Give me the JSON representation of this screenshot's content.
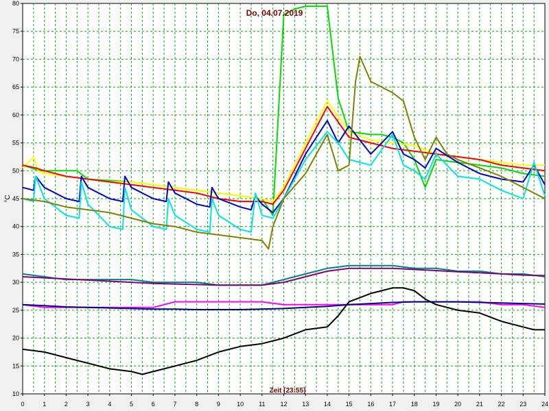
{
  "chart_data": {
    "type": "line",
    "title": "Do, 04.07.2019",
    "xlabel": "Zeit [23:55]",
    "ylabel": "°C",
    "xlim": [
      0,
      24
    ],
    "ylim": [
      10,
      80
    ],
    "x_ticks": [
      "0",
      "1",
      "2",
      "3",
      "4",
      "5",
      "6",
      "7",
      "8",
      "9",
      "10",
      "11",
      "12",
      "13",
      "14",
      "15",
      "16",
      "17",
      "18",
      "19",
      "20",
      "21",
      "22",
      "23",
      "24"
    ],
    "y_ticks": [
      "10",
      "15",
      "20",
      "25",
      "30",
      "35",
      "40",
      "45",
      "50",
      "55",
      "60",
      "65",
      "70",
      "75",
      "80"
    ],
    "grid": true,
    "series": [
      {
        "color": "#00dd00",
        "x": [
          0,
          0.8,
          2.5,
          3,
          5,
          7,
          9,
          10,
          11,
          11.5,
          12,
          12.5,
          13,
          13.5,
          14,
          14.5,
          15,
          16,
          16.5,
          17,
          17.5,
          18,
          18.5,
          19,
          20,
          21,
          22,
          23,
          24
        ],
        "y": [
          51,
          50,
          50,
          48.5,
          48,
          47,
          46,
          45.5,
          45,
          42,
          78,
          79,
          79.5,
          79.5,
          79.5,
          63,
          57,
          56.5,
          56.5,
          56,
          55,
          52,
          47,
          52,
          51.5,
          51,
          50.5,
          49.5,
          49
        ]
      },
      {
        "color": "#ffff00",
        "x": [
          0,
          0.5,
          0.7,
          1,
          2,
          3,
          4,
          5,
          6,
          7,
          8,
          9,
          10,
          11,
          11.5,
          12,
          13,
          14,
          15,
          16,
          17,
          18,
          19,
          20,
          21,
          22,
          23,
          24
        ],
        "y": [
          50.5,
          52.5,
          50,
          49.5,
          49,
          48.5,
          48,
          48,
          47.5,
          47,
          46.5,
          46,
          45.5,
          45,
          44.5,
          47,
          55,
          62.5,
          57,
          55.5,
          55,
          54.5,
          53,
          52.5,
          52,
          51.5,
          51,
          51
        ]
      },
      {
        "color": "#ff0000",
        "x": [
          0,
          0.6,
          1,
          2,
          3,
          4,
          5,
          6,
          7,
          8,
          9,
          10,
          11,
          11.5,
          12,
          13,
          14,
          15,
          16,
          17,
          18,
          19,
          20,
          21,
          22,
          23,
          24
        ],
        "y": [
          51,
          50.5,
          50,
          49,
          48.5,
          48,
          47.5,
          47,
          46.5,
          46,
          45,
          44.5,
          44.5,
          44,
          46.5,
          54,
          61.5,
          56,
          55,
          54,
          53.5,
          53,
          52.5,
          52,
          51,
          50.5,
          50
        ]
      },
      {
        "color": "#0000cc",
        "x": [
          0,
          0.5,
          0.6,
          1,
          2,
          2.6,
          2.7,
          3,
          4,
          4.6,
          4.7,
          5,
          6,
          6.6,
          6.7,
          7,
          8,
          8.6,
          8.7,
          9,
          10,
          10.5,
          10.7,
          11,
          11.5,
          12,
          13,
          14,
          14.5,
          15,
          16,
          17,
          17.5,
          18,
          18.5,
          19,
          20,
          21,
          22,
          23,
          23.5,
          24
        ],
        "y": [
          47,
          46.5,
          49,
          47,
          45,
          44.5,
          49,
          47,
          45,
          44.5,
          49,
          47,
          45,
          44.5,
          48,
          46,
          44,
          43.5,
          47,
          45,
          43.5,
          43,
          45.5,
          44,
          42.5,
          45,
          53,
          59,
          55,
          58,
          53,
          57,
          53,
          52,
          50.5,
          54,
          51.5,
          49.5,
          48.5,
          48,
          51,
          47.5
        ]
      },
      {
        "color": "#00e5e5",
        "x": [
          0,
          0.5,
          0.6,
          1,
          2,
          2.6,
          2.7,
          3,
          4,
          4.6,
          4.7,
          5,
          6,
          6.6,
          6.7,
          7,
          8,
          8.6,
          8.7,
          9,
          10,
          10.5,
          10.7,
          11,
          11.5,
          12,
          13,
          14,
          14.5,
          15,
          16,
          17,
          17.5,
          18,
          18.5,
          19,
          20,
          21,
          22,
          23,
          23.5,
          24
        ],
        "y": [
          45,
          44.5,
          49,
          45,
          42,
          41.5,
          48,
          44,
          40,
          39.5,
          47,
          43,
          40,
          39.5,
          45,
          42,
          39.5,
          39,
          45,
          42,
          39.5,
          39,
          46,
          42,
          41.5,
          45,
          52,
          57,
          55,
          52,
          51,
          56.5,
          51,
          50,
          48.5,
          53,
          49,
          48.5,
          46.5,
          45,
          51.5,
          45.5
        ]
      },
      {
        "color": "#808000",
        "x": [
          0,
          1,
          2,
          3,
          4,
          5,
          6,
          7,
          8,
          9,
          10,
          11,
          11.3,
          11.5,
          12,
          13,
          14,
          14.5,
          15,
          15.3,
          15.5,
          16,
          17,
          17.5,
          18,
          18.5,
          19,
          19.5,
          20,
          21,
          22,
          23,
          24
        ],
        "y": [
          45,
          44.5,
          43.5,
          43,
          42.5,
          41.5,
          40.5,
          40,
          39,
          38.5,
          38,
          37.5,
          36,
          40,
          45,
          49.5,
          56.5,
          50,
          51,
          66,
          70.5,
          66,
          64,
          62.5,
          56,
          52,
          56,
          53,
          52,
          50.5,
          49,
          47,
          45
        ]
      },
      {
        "color": "#008080",
        "x": [
          0,
          1,
          2,
          3,
          4,
          5,
          6,
          7,
          8,
          9,
          10,
          11,
          12,
          13,
          14,
          15,
          16,
          17,
          18,
          19,
          20,
          21,
          22,
          23,
          24
        ],
        "y": [
          31.5,
          31,
          30.5,
          30.5,
          30.5,
          30.5,
          30,
          30,
          30,
          29.5,
          29.5,
          29.5,
          30.5,
          31.5,
          32.5,
          33,
          33,
          33,
          32.5,
          32.5,
          32,
          32,
          31.5,
          31.5,
          31
        ]
      },
      {
        "color": "#800080",
        "x": [
          0,
          1,
          2,
          3,
          4,
          5,
          6,
          7,
          8,
          9,
          10,
          11,
          12,
          13,
          14,
          15,
          16,
          17,
          18,
          19,
          20,
          21,
          22,
          23,
          24
        ],
        "y": [
          31,
          30.8,
          30.6,
          30.4,
          30.2,
          30,
          29.8,
          29.7,
          29.6,
          29.5,
          29.5,
          29.5,
          30,
          31,
          32,
          32.5,
          32.5,
          32.5,
          32.3,
          32.1,
          31.9,
          31.7,
          31.5,
          31.3,
          31.2
        ]
      },
      {
        "color": "#ff00ff",
        "x": [
          0,
          1,
          2,
          3,
          4,
          5,
          6,
          7,
          8,
          9,
          10,
          11,
          12,
          13,
          14,
          15,
          16,
          17,
          17.5,
          18,
          19,
          20,
          21,
          22,
          23,
          24
        ],
        "y": [
          26,
          25.5,
          25.5,
          25.5,
          25.5,
          25.5,
          25.5,
          26.5,
          26.5,
          26.5,
          26.5,
          26.5,
          26,
          26,
          26,
          26,
          26,
          26,
          26.5,
          26.5,
          26.5,
          26.5,
          26.5,
          26,
          26,
          25.5
        ]
      },
      {
        "color": "#000080",
        "x": [
          0,
          1,
          2,
          3,
          4,
          5,
          6,
          7,
          8,
          9,
          10,
          11,
          12,
          13,
          14,
          15,
          16,
          17,
          18,
          19,
          20,
          21,
          22,
          23,
          24
        ],
        "y": [
          26,
          25.8,
          25.6,
          25.5,
          25.4,
          25.3,
          25.2,
          25.2,
          25.1,
          25.1,
          25.1,
          25.2,
          25.3,
          25.5,
          25.7,
          26,
          26.2,
          26.4,
          26.5,
          26.5,
          26.5,
          26.4,
          26.3,
          26.2,
          26.1
        ]
      },
      {
        "color": "#000000",
        "x": [
          0,
          1,
          2,
          3,
          4,
          5,
          5.5,
          6,
          7,
          8,
          9,
          10,
          11,
          12,
          13,
          14,
          14.5,
          15,
          16,
          16.5,
          17,
          17.5,
          18,
          18.5,
          19,
          20,
          21,
          22,
          23,
          23.5,
          24
        ],
        "y": [
          18,
          17.5,
          16.5,
          15.5,
          14.5,
          14,
          13.5,
          14,
          15,
          16,
          17.5,
          18.5,
          19,
          20,
          21.5,
          22,
          24,
          26.5,
          28,
          28.5,
          29,
          29,
          28.5,
          27,
          26,
          25,
          24.5,
          23,
          22,
          21.5,
          21.5
        ]
      }
    ]
  }
}
